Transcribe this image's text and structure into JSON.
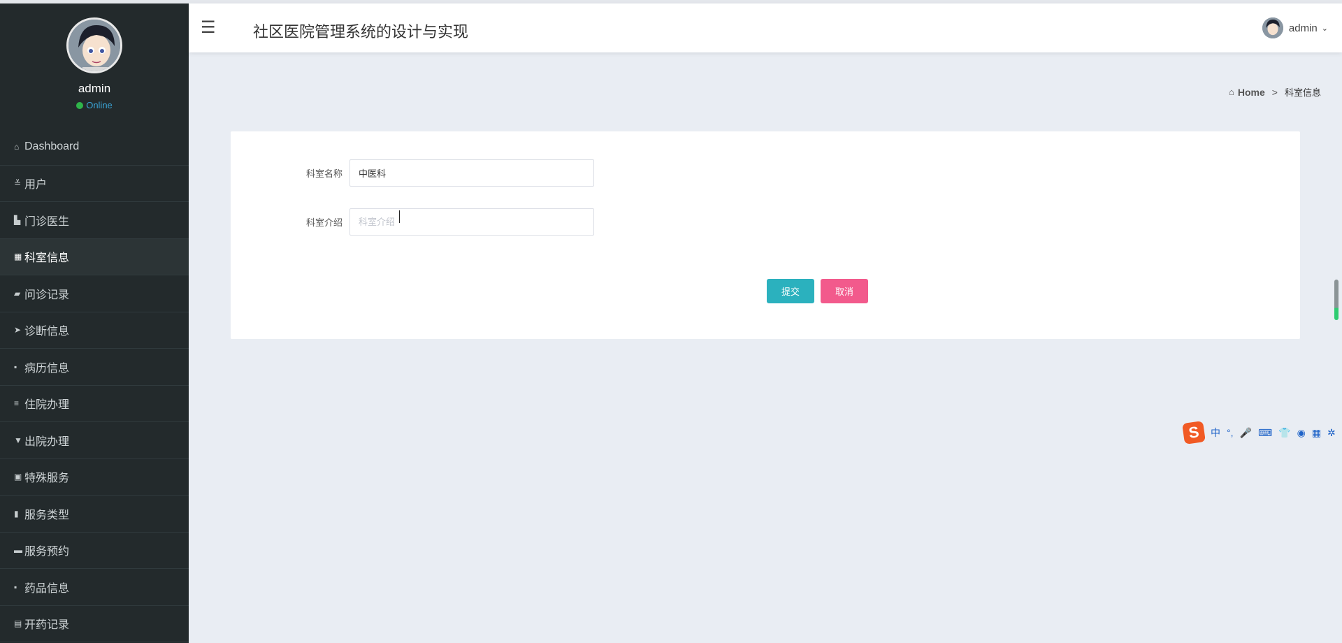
{
  "app": {
    "title": "社区医院管理系统的设计与实现"
  },
  "profile": {
    "name": "admin",
    "status": "Online"
  },
  "sidebar": {
    "items": [
      {
        "label": "Dashboard",
        "icon": "home-icon",
        "glyph": "⌂"
      },
      {
        "label": "用户",
        "icon": "sliders-icon",
        "glyph": "≚"
      },
      {
        "label": "门诊医生",
        "icon": "building-icon",
        "glyph": "▙"
      },
      {
        "label": "科室信息",
        "icon": "grid-icon",
        "glyph": "▦",
        "active": true
      },
      {
        "label": "问诊记录",
        "icon": "thumb-icon",
        "glyph": "▰"
      },
      {
        "label": "诊断信息",
        "icon": "send-icon",
        "glyph": "➤"
      },
      {
        "label": "病历信息",
        "icon": "apps-icon",
        "glyph": "▪"
      },
      {
        "label": "住院办理",
        "icon": "list-icon",
        "glyph": "≡"
      },
      {
        "label": "出院办理",
        "icon": "pin-icon",
        "glyph": "▼"
      },
      {
        "label": "特殊服务",
        "icon": "checklist-icon",
        "glyph": "▣"
      },
      {
        "label": "服务类型",
        "icon": "bar-chart-icon",
        "glyph": "▮"
      },
      {
        "label": "服务预约",
        "icon": "monitor-icon",
        "glyph": "▬"
      },
      {
        "label": "药品信息",
        "icon": "apps-icon",
        "glyph": "▪"
      },
      {
        "label": "开药记录",
        "icon": "clipboard-icon",
        "glyph": "▤"
      }
    ]
  },
  "header": {
    "user": "admin",
    "menu_icon": "☰"
  },
  "breadcrumb": {
    "home": "Home",
    "separator": ">",
    "current": "科室信息"
  },
  "form": {
    "name_label": "科室名称",
    "name_value": "中医科",
    "intro_label": "科室介绍",
    "intro_placeholder": "科室介绍",
    "submit_label": "提交",
    "cancel_label": "取消"
  },
  "ime": {
    "logo": "S",
    "icons": [
      "中",
      "°,",
      "🎤",
      "⌨",
      "👕",
      "◉",
      "▦",
      "✲"
    ]
  },
  "colors": {
    "sidebar_bg": "#232a2c",
    "submit": "#2bb1be",
    "cancel": "#f25a8c",
    "online": "#2fb44a"
  }
}
